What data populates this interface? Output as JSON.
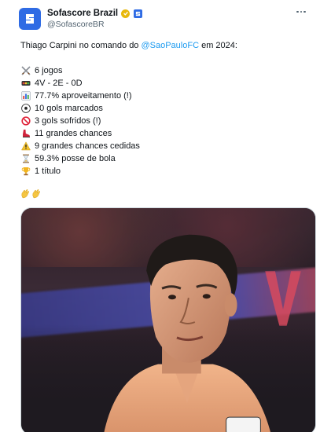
{
  "account": {
    "display_name": "Sofascore Brazil",
    "handle": "@SofascoreBR",
    "brand_color": "#2f6be4",
    "verified_color": "#e8b80c"
  },
  "tweet": {
    "intro_before": "Thiago Carpini no comando do ",
    "mention": "@SaoPauloFC",
    "intro_after": " em 2024:",
    "mention_color": "#1d9bf0",
    "stats": [
      {
        "icon": "crossed-swords-icon",
        "text": "6 jogos"
      },
      {
        "icon": "traffic-light-icon",
        "text": "4V - 2E - 0D"
      },
      {
        "icon": "bar-chart-icon",
        "text": "77.7% aproveitamento (!)"
      },
      {
        "icon": "soccer-ball-icon",
        "text": "10 gols marcados"
      },
      {
        "icon": "prohibited-icon",
        "text": "3 gols sofridos (!)"
      },
      {
        "icon": "football-boot-icon",
        "text": "11 grandes chances"
      },
      {
        "icon": "warning-icon",
        "text": "9 grandes chances cedidas"
      },
      {
        "icon": "hourglass-icon",
        "text": "59.3% posse de bola"
      },
      {
        "icon": "trophy-icon",
        "text": "1 título"
      }
    ],
    "closing_emoji": [
      "clapping-hands-icon",
      "clapping-hands-icon"
    ]
  },
  "media": {
    "description_icon": "photo-of-coach"
  }
}
